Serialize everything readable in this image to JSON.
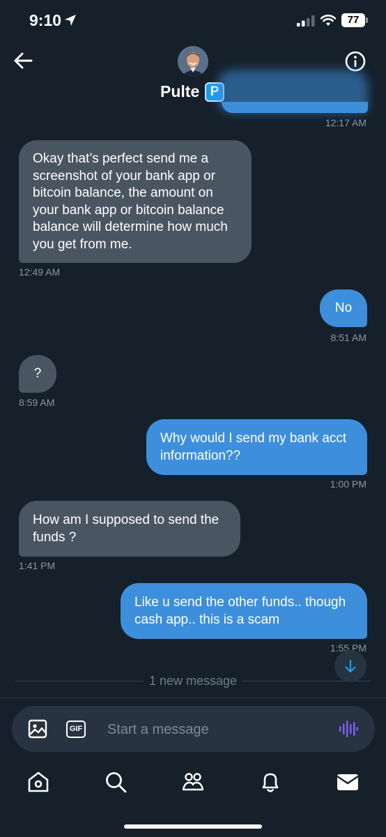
{
  "status_bar": {
    "time": "9:10",
    "battery": "77"
  },
  "header": {
    "contact_name": "Pulte",
    "badge": "P"
  },
  "messages": [
    {
      "direction": "out",
      "text": "",
      "time": "12:17 AM"
    },
    {
      "direction": "in",
      "text": "Okay that’s perfect send me a screenshot of your bank app or bitcoin balance, the amount on your bank app or bitcoin balance balance will determine how much you get from me.",
      "time": "12:49 AM"
    },
    {
      "direction": "out",
      "text": "No",
      "time": "8:51 AM"
    },
    {
      "direction": "in",
      "text": "?",
      "time": "8:59 AM"
    },
    {
      "direction": "out",
      "text": "Why would I send my bank acct information??",
      "time": "1:00 PM"
    },
    {
      "direction": "in",
      "text": "How am I supposed to send the funds ?",
      "time": "1:41 PM"
    },
    {
      "direction": "out",
      "text": "Like u send the other funds.. though cash app.. this is a scam",
      "time": "1:55 PM"
    }
  ],
  "new_message_label": "1 new message",
  "composer": {
    "placeholder": "Start a message",
    "gif_label": "GIF"
  },
  "colors": {
    "background": "#15202b",
    "incoming_bubble": "#4a5562",
    "outgoing_bubble": "#3d8fdc",
    "accent": "#1d9bf0",
    "voice_icon": "#7b5cf0"
  },
  "tabs": [
    "home-icon",
    "search-icon",
    "communities-icon",
    "notifications-icon",
    "messages-icon"
  ]
}
